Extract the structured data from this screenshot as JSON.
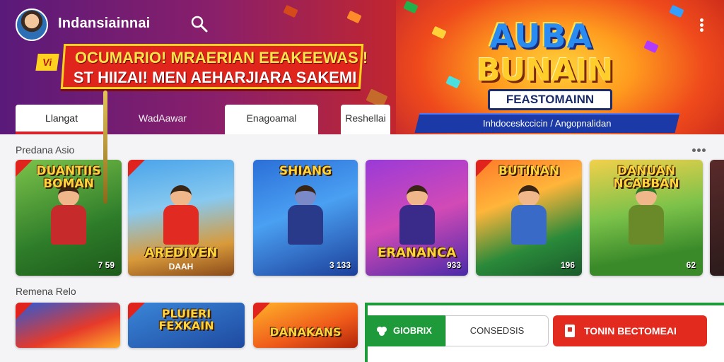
{
  "header": {
    "app_title": "Indansiainnai",
    "promo_tag": "Vi",
    "promo_line1": "OCUMARIO! MRAERIAN EEAKEEWAS !",
    "promo_line2": "ST HIIZAI! MEN AEHARJIARA SAKEMI"
  },
  "hero": {
    "logo_top": "AUBA",
    "logo_mid": "BUNAIN",
    "logo_sub": "FEASTOMAINN",
    "strip_text": "Inhdoceskccicin / Angopnalidan",
    "accent": "#e22a1f",
    "brand_blue": "#1b3aa8"
  },
  "tabs": [
    {
      "label": "Llangat",
      "active": true
    },
    {
      "label": "WadAawar",
      "active": false
    },
    {
      "label": "Enagoamal",
      "active": false
    },
    {
      "label": "Reshellai",
      "active": false
    }
  ],
  "sections": {
    "first_title": "Predana Asio",
    "second_title": "Remena Relo"
  },
  "cards": [
    {
      "title": "DUANTIIS BOMAN",
      "count": "7 59",
      "position": "top"
    },
    {
      "title": "AREDIVEN",
      "subtitle": "DAAH",
      "position": "bottom"
    },
    {
      "title": "SHIANG",
      "count": "3 133",
      "position": "top"
    },
    {
      "title": "ERANANCA",
      "count": "933",
      "position": "bottom"
    },
    {
      "title": "BUTINAN",
      "count": "196",
      "position": "top"
    },
    {
      "title": "DANUAN NCABBAN",
      "count": "62",
      "position": "top"
    }
  ],
  "row2_cards": [
    {
      "title": ""
    },
    {
      "title": "PLUIERI FEXKAIN"
    },
    {
      "title": "DANAKANS"
    }
  ],
  "cta": {
    "green_label": "GIOBRIX",
    "outline_label": "CONSEDSIS",
    "red_label": "TONIN BECTOMEAI"
  },
  "colors": {
    "green": "#1e9a3a",
    "red": "#e22a1f",
    "tab_indicator": "#d7232a"
  }
}
